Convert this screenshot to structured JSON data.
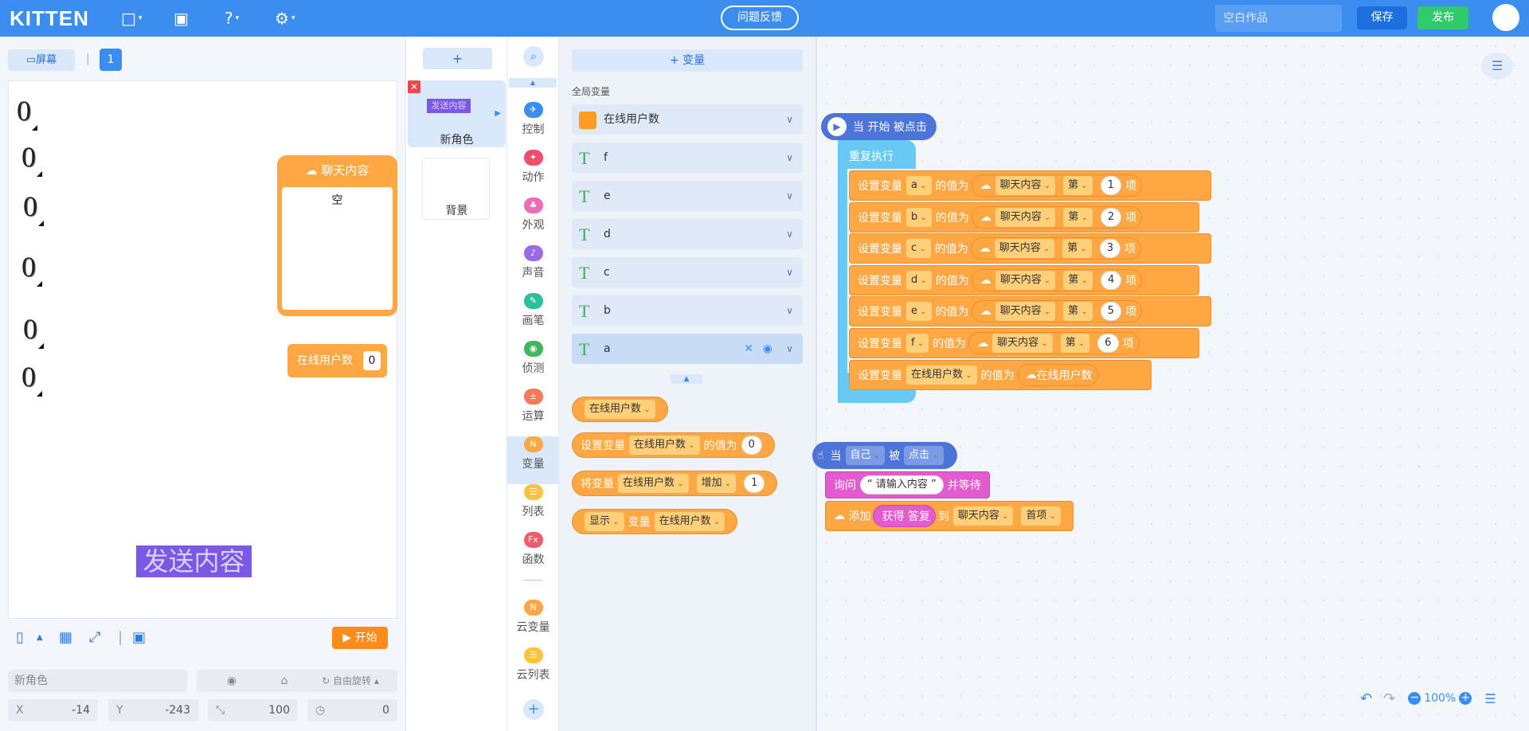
{
  "topbar": {
    "logo": "KITTEN",
    "feedback_label": "问题反馈",
    "work_name": "空白作品",
    "save_label": "保存",
    "publish_label": "发布"
  },
  "stage_panel": {
    "screen_label": "屏幕",
    "page_number": "1",
    "zero_values": [
      "0",
      "0",
      "0",
      "0",
      "0",
      "0"
    ],
    "chat_box": {
      "title": "聊天内容",
      "content": "空"
    },
    "var_monitor": {
      "label": "在线用户数",
      "value": "0"
    },
    "send_text": "发送内容",
    "start_label": "开始",
    "sprite_name": "新角色",
    "rotation_label": "自由旋转",
    "x_label": "X",
    "x_value": "-14",
    "y_label": "Y",
    "y_value": "-243",
    "size_value": "100",
    "angle_value": "0"
  },
  "sprites": {
    "add_label": "+",
    "sprite_thumb_text": "发送内容",
    "sprite_name": "新角色",
    "background_label": "背景"
  },
  "categories": [
    {
      "label": "控制",
      "color": "#3b8ef0"
    },
    {
      "label": "动作",
      "color": "#f04d6a"
    },
    {
      "label": "外观",
      "color": "#ee6bb5"
    },
    {
      "label": "声音",
      "color": "#9b6be6"
    },
    {
      "label": "画笔",
      "color": "#2dbf9d"
    },
    {
      "label": "侦测",
      "color": "#3fb85c"
    },
    {
      "label": "运算",
      "color": "#f37a58"
    },
    {
      "label": "变量",
      "color": "#ffa743"
    },
    {
      "label": "列表",
      "color": "#ffc23d"
    },
    {
      "label": "函数",
      "color": "#f25a6c"
    },
    {
      "label": "云变量",
      "color": "#ffa743"
    },
    {
      "label": "云列表",
      "color": "#ffc23d"
    }
  ],
  "variables": {
    "add_label": "+ 变量",
    "section_label": "全局变量",
    "rows": [
      "在线用户数",
      "f",
      "e",
      "d",
      "c",
      "b",
      "a"
    ],
    "block_var": "在线用户数",
    "set_label": "设置变量",
    "set_value_label": "的值为",
    "set_value": "0",
    "change_label": "将变量",
    "change_op": "增加",
    "change_value": "1",
    "show_op": "显示",
    "show_label": "变量"
  },
  "script": {
    "hat_label": "当 开始 被点击",
    "repeat_label": "重复执行",
    "set_label": "设置变量",
    "value_label": "的值为",
    "list_name": "聊天内容",
    "nth_label": "第",
    "item_label": "项",
    "rows": [
      {
        "var": "a",
        "index": "1"
      },
      {
        "var": "b",
        "index": "2"
      },
      {
        "var": "c",
        "index": "3"
      },
      {
        "var": "d",
        "index": "4"
      },
      {
        "var": "e",
        "index": "5"
      },
      {
        "var": "f",
        "index": "6"
      }
    ],
    "last_var": "在线用户数",
    "cloud_var": "在线用户数",
    "hat2_when": "当",
    "hat2_self": "自己",
    "hat2_by": "被",
    "hat2_event": "点击",
    "ask_label": "询问",
    "ask_text": "“ 请输入内容 ”",
    "ask_wait": "并等待",
    "add_label": "添加",
    "answer_label": "获得 答复",
    "to_label": "到",
    "add_list": "聊天内容",
    "add_pos": "首项"
  },
  "zoom": {
    "level": "100%"
  }
}
